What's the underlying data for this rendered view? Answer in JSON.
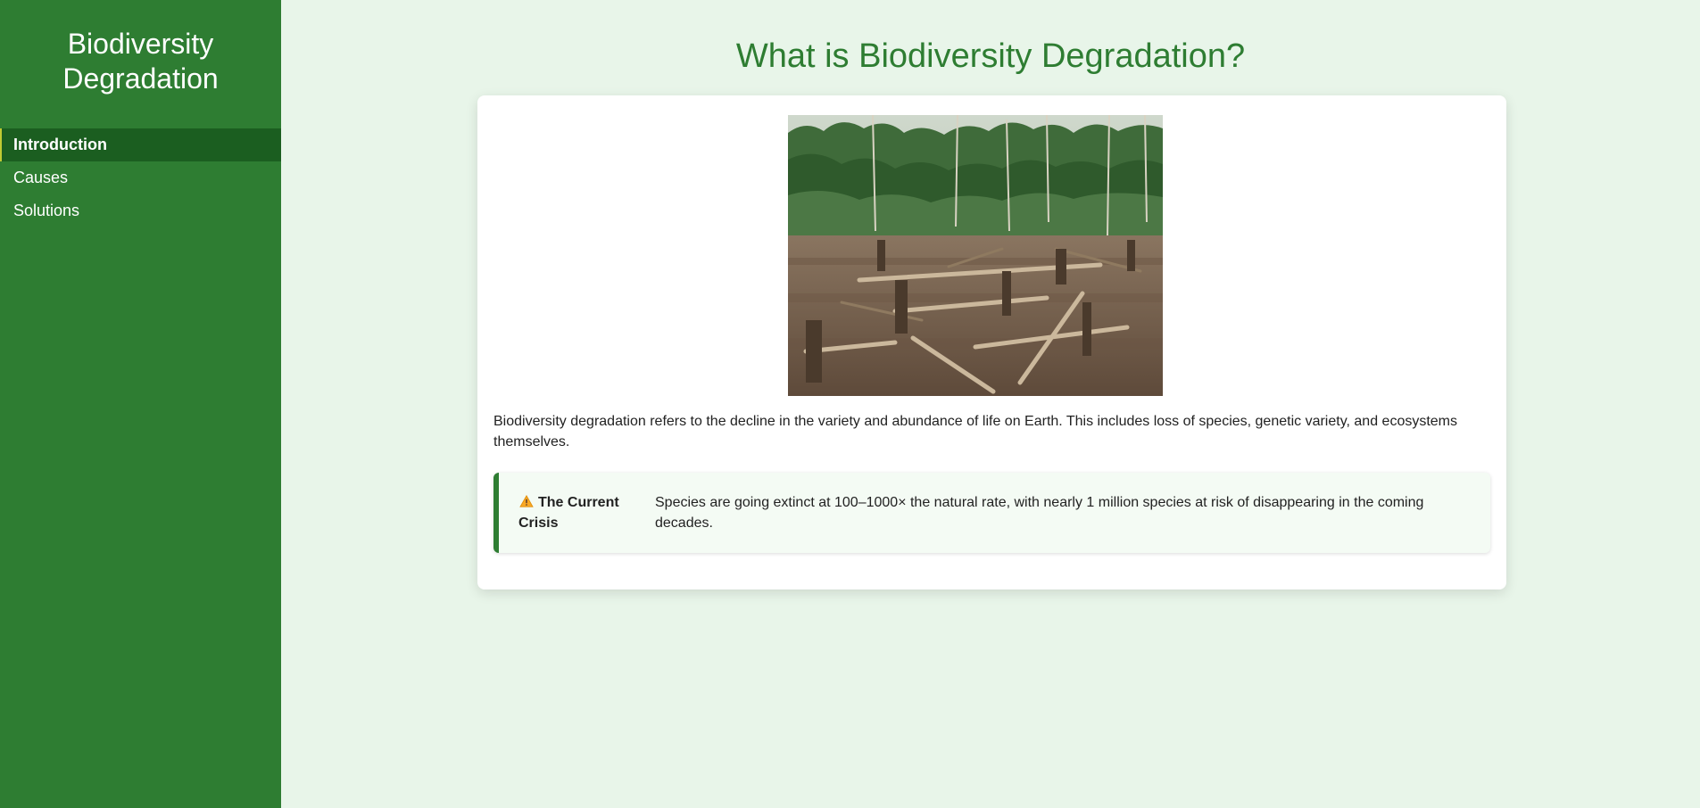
{
  "sidebar": {
    "title": "Biodiversity Degradation",
    "items": [
      {
        "label": "Introduction",
        "active": true
      },
      {
        "label": "Causes",
        "active": false
      },
      {
        "label": "Solutions",
        "active": false
      }
    ]
  },
  "main": {
    "title": "What is Biodiversity Degradation?",
    "image": {
      "icon": "deforestation-photo"
    },
    "intro": "Biodiversity degradation refers to the decline in the variety and abundance of life on Earth. This includes loss of species, genetic variety, and ecosystems themselves.",
    "crisis": {
      "icon": "warning-icon",
      "label": "The Current Crisis",
      "text": "Species are going extinct at 100–1000× the natural rate, with nearly 1 million species at risk of disappearing in the coming decades."
    }
  },
  "colors": {
    "sidebar_bg": "#2e7d32",
    "active_item_bg": "#1b5e20",
    "page_bg": "#e8f5e9",
    "title_green": "#2e7d32",
    "warning_orange": "#f9a825"
  }
}
